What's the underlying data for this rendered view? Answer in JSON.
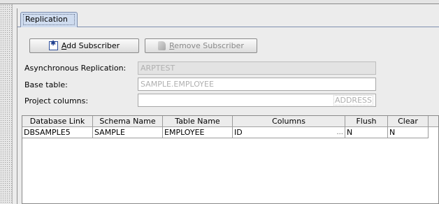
{
  "tabs": [
    {
      "label": "Replication",
      "selected": true
    }
  ],
  "toolbar": {
    "add_subscriber": {
      "prefix": "",
      "mnemonic": "A",
      "rest": "dd Subscriber",
      "enabled": true
    },
    "remove_subscriber": {
      "prefix": "",
      "mnemonic": "R",
      "rest": "emove Subscriber",
      "enabled": false
    }
  },
  "form": {
    "async_replication": {
      "label": "Asynchronous Replication:",
      "value": "ARPTEST"
    },
    "base_table": {
      "label": "Base table:",
      "value": "SAMPLE.EMPLOYEE"
    },
    "project_columns": {
      "label": "Project columns:",
      "value": "ADDRESS"
    }
  },
  "table": {
    "columns": [
      "Database Link",
      "Schema Name",
      "Table Name",
      "Columns",
      "Flush",
      "Clear"
    ],
    "rows": [
      {
        "database_link": "DBSAMPLE5",
        "schema_name": "SAMPLE",
        "table_name": "EMPLOYEE",
        "columns": "ID",
        "columns_more": "...",
        "flush": "N",
        "clear": "N"
      }
    ]
  }
}
